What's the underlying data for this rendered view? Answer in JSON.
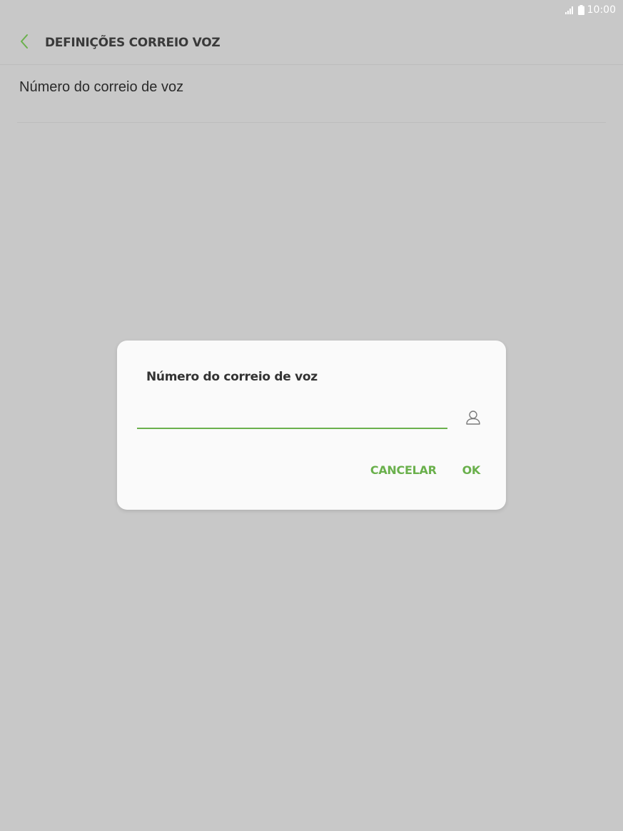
{
  "status_bar": {
    "time": "10:00",
    "icons": [
      "signal-icon",
      "battery-icon"
    ]
  },
  "header": {
    "back_icon": "chevron-left-icon",
    "title": "DEFINIÇÕES CORREIO VOZ"
  },
  "settings": {
    "items": [
      {
        "label": "Número do correio de voz"
      }
    ]
  },
  "dialog": {
    "title": "Número do correio de voz",
    "input_value": "",
    "input_placeholder": "",
    "contact_icon": "contact-person-icon",
    "cancel_label": "CANCELAR",
    "ok_label": "OK"
  },
  "colors": {
    "accent": "#6ab04c",
    "background_dimmed": "#c8c8c8",
    "dialog_background": "#fafafa",
    "title_text": "#3a3a3a"
  }
}
